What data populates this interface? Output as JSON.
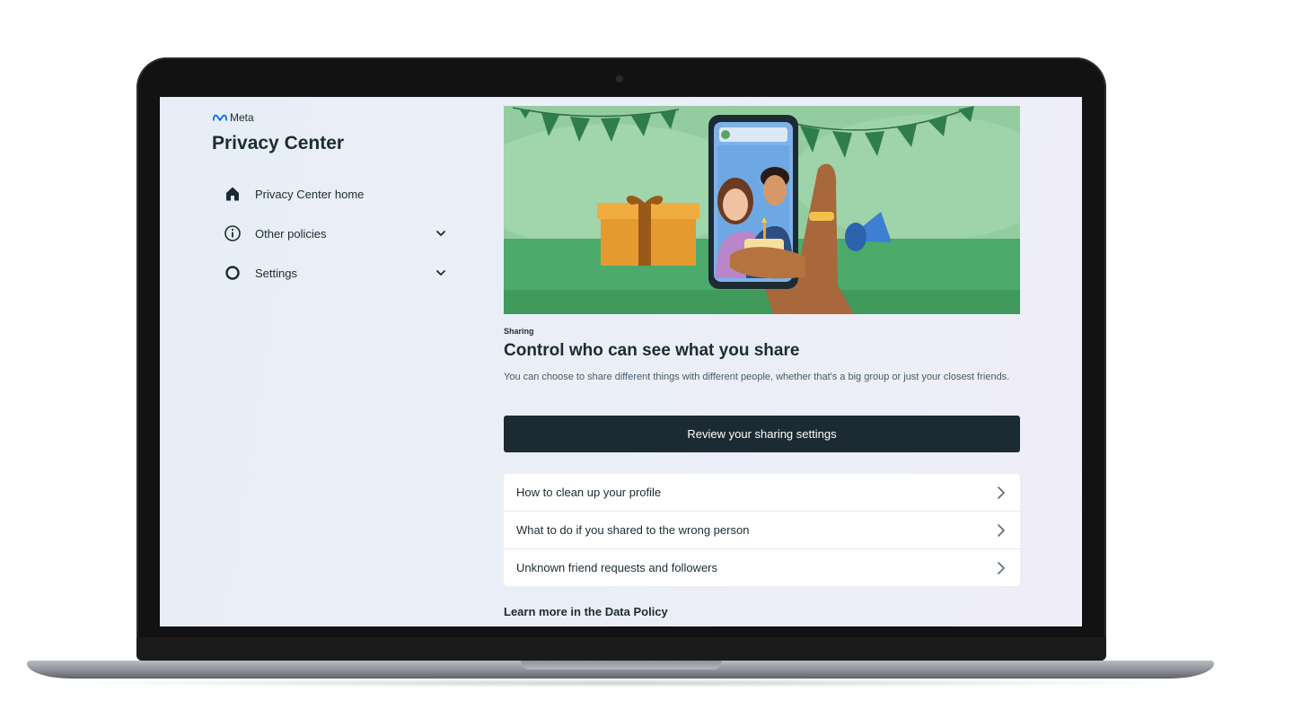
{
  "brand": {
    "name": "Meta",
    "icon": "meta-logo-icon"
  },
  "sidebar": {
    "title": "Privacy Center",
    "items": [
      {
        "label": "Privacy Center home",
        "icon": "home-icon",
        "expandable": false
      },
      {
        "label": "Other policies",
        "icon": "info-circle-icon",
        "expandable": true
      },
      {
        "label": "Settings",
        "icon": "settings-ring-icon",
        "expandable": true
      }
    ]
  },
  "main": {
    "eyebrow": "Sharing",
    "headline": "Control who can see what you share",
    "description": "You can choose to share different things with different people, whether that's a big group or just your closest friends.",
    "primary_button": "Review your sharing settings",
    "links": [
      {
        "label": "How to clean up your profile"
      },
      {
        "label": "What to do if you shared to the wrong person"
      },
      {
        "label": "Unknown friend requests and followers"
      }
    ],
    "footer_link": "Learn more in the Data Policy"
  },
  "colors": {
    "ink": "#1c2b33",
    "hero_green": "#8ec79a",
    "button_dark": "#1c2b33"
  }
}
